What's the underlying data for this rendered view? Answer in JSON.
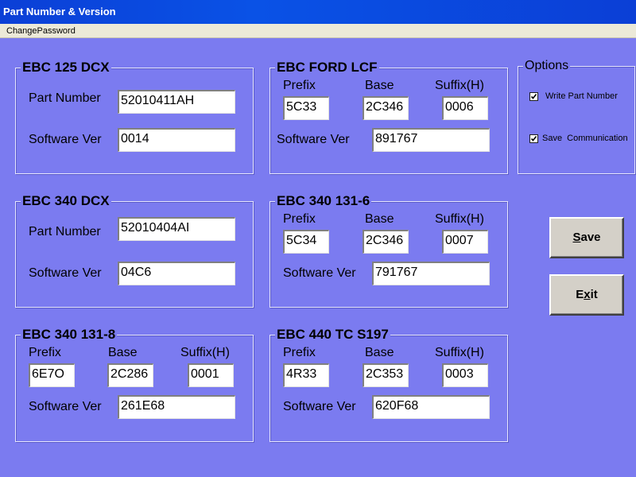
{
  "window": {
    "title": "Part Number & Version"
  },
  "menu": {
    "change_password": "ChangePassword"
  },
  "labels": {
    "part_number": "Part Number",
    "software_ver": "Software Ver",
    "prefix": "Prefix",
    "base": "Base",
    "suffix": "Suffix(H)"
  },
  "ebc125dcx": {
    "title": "EBC 125 DCX",
    "part_number": "52010411AH",
    "software_ver": "0014"
  },
  "ebc340dcx": {
    "title": "EBC 340 DCX",
    "part_number": "52010404AI",
    "software_ver": "04C6"
  },
  "ebc340_131_8": {
    "title": "EBC 340 131-8",
    "prefix": "6E7O",
    "base": "2C286",
    "suffix": "0001",
    "software_ver": "261E68"
  },
  "ebcford": {
    "title": "EBC FORD LCF",
    "prefix": "5C33",
    "base": "2C346",
    "suffix": "0006",
    "software_ver": "891767"
  },
  "ebc340_131_6": {
    "title": "EBC 340 131-6",
    "prefix": "5C34",
    "base": "2C346",
    "suffix": "0007",
    "software_ver": "791767"
  },
  "ebc440": {
    "title": "EBC 440 TC S197",
    "prefix": "4R33",
    "base": "2C353",
    "suffix": "0003",
    "software_ver": "620F68"
  },
  "options": {
    "title": "Options",
    "write_part_number": {
      "label": "Write Part Number",
      "checked": true
    },
    "save_communication": {
      "label": "Save  Communication",
      "checked": true
    }
  },
  "buttons": {
    "save": {
      "pre": "",
      "accel": "S",
      "post": "ave"
    },
    "exit": {
      "pre": "E",
      "accel": "x",
      "post": "it"
    }
  }
}
